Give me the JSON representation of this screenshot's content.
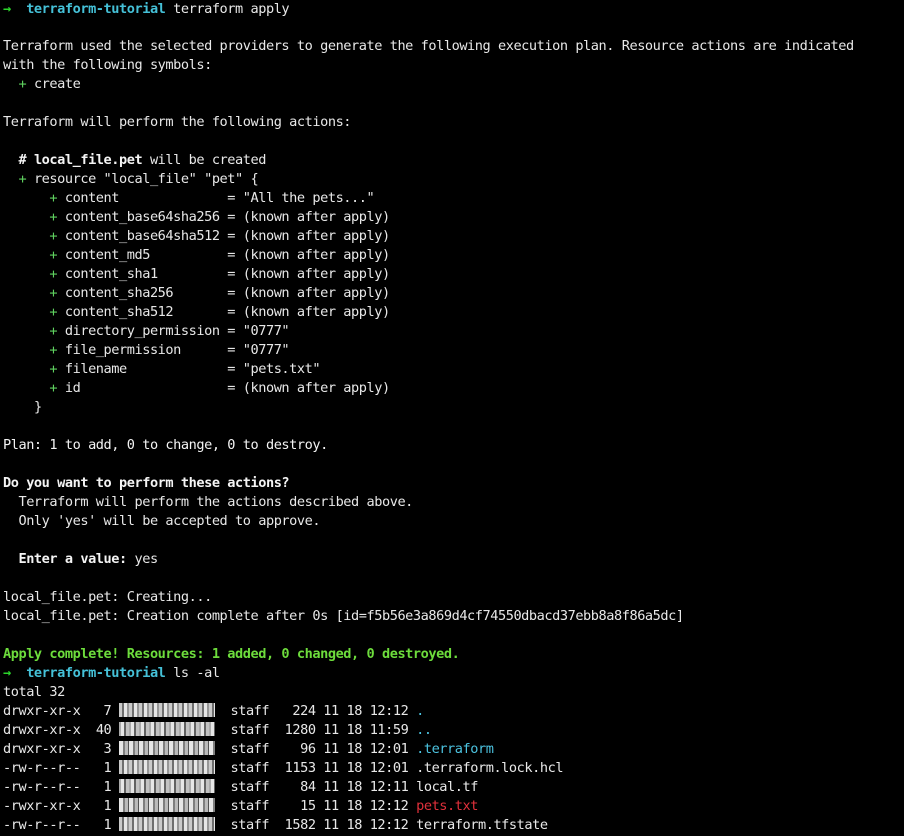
{
  "prompt": {
    "arrow": "→",
    "directory": "terraform-tutorial"
  },
  "commands": {
    "apply": "terraform apply",
    "list": "ls -al"
  },
  "plan_intro": {
    "line1": "Terraform used the selected providers to generate the following execution plan. Resource actions are indicated",
    "line2": "with the following symbols:",
    "symbol": "+",
    "symbol_label": "create"
  },
  "actions_header": "Terraform will perform the following actions:",
  "resource": {
    "comment_hash": "#",
    "comment_name": "local_file.pet",
    "comment_rest": "will be created",
    "plus": "+",
    "declaration": "resource \"local_file\" \"pet\" {",
    "attributes": [
      {
        "name": "content             ",
        "value": "\"All the pets...\""
      },
      {
        "name": "content_base64sha256",
        "value": "(known after apply)"
      },
      {
        "name": "content_base64sha512",
        "value": "(known after apply)"
      },
      {
        "name": "content_md5         ",
        "value": "(known after apply)"
      },
      {
        "name": "content_sha1        ",
        "value": "(known after apply)"
      },
      {
        "name": "content_sha256      ",
        "value": "(known after apply)"
      },
      {
        "name": "content_sha512      ",
        "value": "(known after apply)"
      },
      {
        "name": "directory_permission",
        "value": "\"0777\""
      },
      {
        "name": "file_permission     ",
        "value": "\"0777\""
      },
      {
        "name": "filename            ",
        "value": "\"pets.txt\""
      },
      {
        "name": "id                  ",
        "value": "(known after apply)"
      }
    ],
    "closing_brace": "}"
  },
  "plan_summary": "Plan: 1 to add, 0 to change, 0 to destroy.",
  "confirm": {
    "question": "Do you want to perform these actions?",
    "detail1": "Terraform will perform the actions described above.",
    "detail2": "Only 'yes' will be accepted to approve.",
    "input_label": "Enter a value:",
    "input_value": "yes"
  },
  "progress": {
    "creating": "local_file.pet: Creating...",
    "complete": "local_file.pet: Creation complete after 0s [id=f5b56e3a869d4cf74550dbacd37ebb8a8f86a5dc]"
  },
  "apply_complete": "Apply complete! Resources: 1 added, 0 changed, 0 destroyed.",
  "listing": {
    "total": "total 32",
    "entries": [
      {
        "perms": "drwxr-xr-x",
        "links": "7",
        "group": "staff",
        "size": "224",
        "month": "11",
        "day": "18",
        "time": "12:12",
        "name": ".",
        "name_color": "cyan"
      },
      {
        "perms": "drwxr-xr-x",
        "links": "40",
        "group": "staff",
        "size": "1280",
        "month": "11",
        "day": "18",
        "time": "11:59",
        "name": "..",
        "name_color": "cyan"
      },
      {
        "perms": "drwxr-xr-x",
        "links": "3",
        "group": "staff",
        "size": "96",
        "month": "11",
        "day": "18",
        "time": "12:01",
        "name": ".terraform",
        "name_color": "cyan"
      },
      {
        "perms": "-rw-r--r--",
        "links": "1",
        "group": "staff",
        "size": "1153",
        "month": "11",
        "day": "18",
        "time": "12:01",
        "name": ".terraform.lock.hcl",
        "name_color": "default"
      },
      {
        "perms": "-rw-r--r--",
        "links": "1",
        "group": "staff",
        "size": "84",
        "month": "11",
        "day": "18",
        "time": "12:11",
        "name": "local.tf",
        "name_color": "default"
      },
      {
        "perms": "-rwxr-xr-x",
        "links": "1",
        "group": "staff",
        "size": "15",
        "month": "11",
        "day": "18",
        "time": "12:12",
        "name": "pets.txt",
        "name_color": "red"
      },
      {
        "perms": "-rw-r--r--",
        "links": "1",
        "group": "staff",
        "size": "1582",
        "month": "11",
        "day": "18",
        "time": "12:12",
        "name": "terraform.tfstate",
        "name_color": "default"
      }
    ]
  },
  "colors": {
    "background": "#000000",
    "text": "#e8e8e8",
    "prompt_arrow": "#2bd52b",
    "prompt_dir": "#45c1d8",
    "plus": "#5fd15f",
    "success": "#6ddc3c",
    "directory": "#4cc3e0",
    "executable": "#e0303b"
  }
}
